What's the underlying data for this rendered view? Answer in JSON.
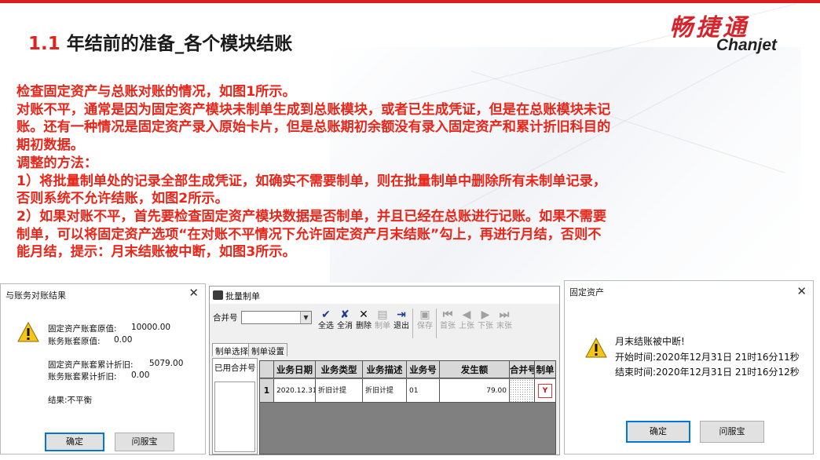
{
  "slide": {
    "title_number": "1.1",
    "title_text": "年结前的准备_各个模块结账",
    "logo_cn": "畅捷通",
    "logo_en": "Chanjet",
    "paragraphs": [
      "检查固定资产与总账对账的情况，如图1所示。",
      "对账不平，通常是因为固定资产模块未制单生成到总账模块，或者已生成凭证，但是在总账模块未记",
      "账。还有一种情况是固定资产录入原始卡片，但是总账期初余额没有录入固定资产和累计折旧科目的",
      "期初数据。",
      "调整的方法：",
      "1）将批量制单处的记录全部生成凭证，如确实不需要制单，则在批量制单中删除所有未制单记录，",
      "否则系统不允许结账，如图2所示。",
      "2）如果对账不平，首先要检查固定资产模块数据是否制单，并且已经在总账进行记账。如果不需要",
      "制单，可以将固定资产选项“在对账不平情况下允许固定资产月末结账”勾上，再进行月结，否则不",
      "能月结，提示：月末结账被中断，如图3所示。"
    ]
  },
  "dialog1": {
    "title": "与账务对账结果",
    "close": "✕",
    "lines": [
      {
        "label": "固定资产账套原值:",
        "value": "10000.00"
      },
      {
        "label": "账务账套原值:",
        "value": "0.00"
      },
      {
        "label": "固定资产账套累计折旧:",
        "value": "5079.00"
      },
      {
        "label": "账务账套累计折旧:",
        "value": "0.00"
      }
    ],
    "result": "结果:不平衡",
    "ok": "确定",
    "help": "问服宝"
  },
  "batch": {
    "title": "批量制单",
    "merge_label": "合并号",
    "tools": [
      {
        "icon": "✔",
        "label": "全选",
        "disabled": false
      },
      {
        "icon": "✘",
        "label": "全消",
        "disabled": false
      },
      {
        "icon": "✕",
        "label": "删除",
        "disabled": false
      },
      {
        "icon": "▤",
        "label": "制单",
        "disabled": true
      },
      {
        "icon": "⇥",
        "label": "退出",
        "disabled": false
      },
      {
        "icon": "▣",
        "label": "保存",
        "disabled": true
      },
      {
        "icon": "⏮",
        "label": "首张",
        "disabled": true
      },
      {
        "icon": "◀",
        "label": "上张",
        "disabled": true
      },
      {
        "icon": "▶",
        "label": "下张",
        "disabled": true
      },
      {
        "icon": "⏭",
        "label": "末张",
        "disabled": true
      }
    ],
    "tabs": [
      "制单选择",
      "制单设置"
    ],
    "used_merge_label": "已用合并号",
    "headers": [
      "",
      "业务日期",
      "业务类型",
      "业务描述",
      "业务号",
      "发生额",
      "合并号",
      "制单"
    ],
    "row": {
      "num": "1",
      "date": "2020.12.31",
      "type": "折旧计提",
      "desc": "折旧计提",
      "bizno": "01",
      "amount": "79.00",
      "merge": "",
      "flag": "Y"
    }
  },
  "dialog3": {
    "title": "固定资产",
    "close": "✕",
    "message": "月末结账被中断!",
    "start": "开始时间:2020年12月31日 21时16分11秒",
    "end": "结束时间:2020年12月31日 21时16分12秒",
    "ok": "确定",
    "help": "问服宝"
  },
  "colors": {
    "accent_red": "#e8261a",
    "brand_red": "#d8232a"
  }
}
